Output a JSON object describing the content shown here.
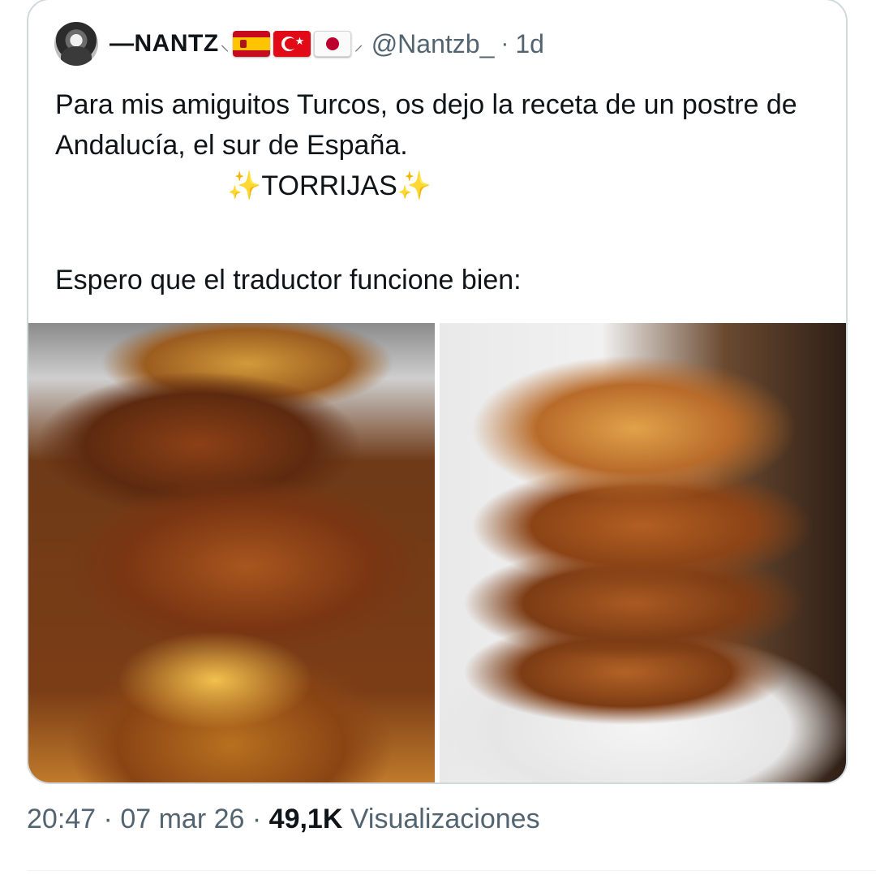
{
  "quoted_tweet": {
    "display_name": "—NANTZ",
    "handle": "@Nantzb_",
    "separator": "·",
    "time_ago": "1d",
    "flags": [
      "flag-spain-icon",
      "flag-turkey-icon",
      "flag-japan-icon"
    ],
    "text_line_1": "Para mis amiguitos Turcos, os dejo la receta de un postre de Andalucía, el sur de España.",
    "sparkle": "✨",
    "title": "TORRIJAS",
    "text_line_3": "Espero que el traductor funcione bien:",
    "images": [
      "torrijas-plate-photo",
      "torrijas-stack-photo"
    ]
  },
  "meta": {
    "time": "20:47",
    "separator": "·",
    "date": "07 mar 26",
    "views_count": "49,1K",
    "views_label": "Visualizaciones"
  }
}
